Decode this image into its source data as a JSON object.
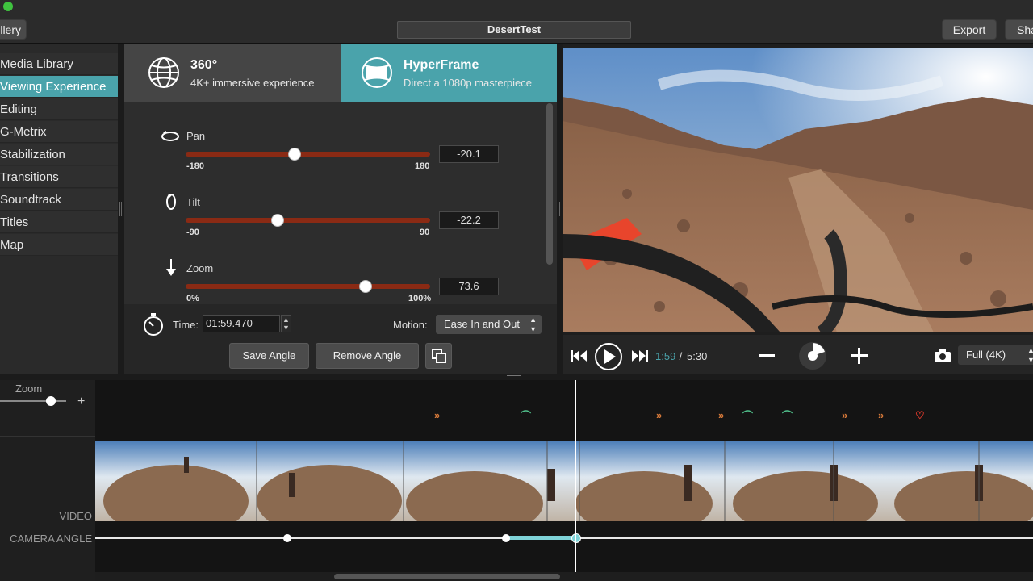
{
  "toolbar": {
    "gallery_label": "llery",
    "document_title": "DesertTest",
    "export_label": "Export",
    "share_label": "Sha"
  },
  "sidebar": {
    "items": [
      {
        "label": "Media Library"
      },
      {
        "label": "Viewing Experience",
        "active": true
      },
      {
        "label": "Editing"
      },
      {
        "label": "G-Metrix"
      },
      {
        "label": "Stabilization"
      },
      {
        "label": "Transitions"
      },
      {
        "label": "Soundtrack"
      },
      {
        "label": "Titles"
      },
      {
        "label": "Map"
      }
    ]
  },
  "modes": {
    "m360": {
      "title": "360°",
      "subtitle": "4K+ immersive experience",
      "icon": "globe-icon"
    },
    "hyperframe": {
      "title": "HyperFrame",
      "subtitle": "Direct a 1080p masterpiece",
      "icon": "globe-frame-icon",
      "selected": true
    }
  },
  "controls": {
    "pan": {
      "label": "Pan",
      "min": "-180",
      "max": "180",
      "value": "-20.1",
      "numeric": -20.1
    },
    "tilt": {
      "label": "Tilt",
      "min": "-90",
      "max": "90",
      "value": "-22.2",
      "numeric": -22.2
    },
    "zoom": {
      "label": "Zoom",
      "min": "0%",
      "max": "100%",
      "value": "73.6",
      "numeric": 73.6
    }
  },
  "keyframe": {
    "time_label": "Time:",
    "time_value": "01:59.470",
    "motion_label": "Motion:",
    "motion_value": "Ease In and Out",
    "save_label": "Save Angle",
    "remove_label": "Remove Angle"
  },
  "playback": {
    "current_time": "1:59",
    "separator": " / ",
    "total_time": "5:30",
    "quality": "Full (4K)"
  },
  "timeline": {
    "zoom_label": "Zoom",
    "zoom_plus": "+",
    "video_label": "VIDEO",
    "camera_label": "CAMERA ANGLE"
  },
  "colors": {
    "accent": "#4aa3ab",
    "slider_track": "#8a2a14",
    "marker_orange": "#d87a3a",
    "marker_green": "#4fbf8a",
    "marker_red": "#e0392b"
  }
}
